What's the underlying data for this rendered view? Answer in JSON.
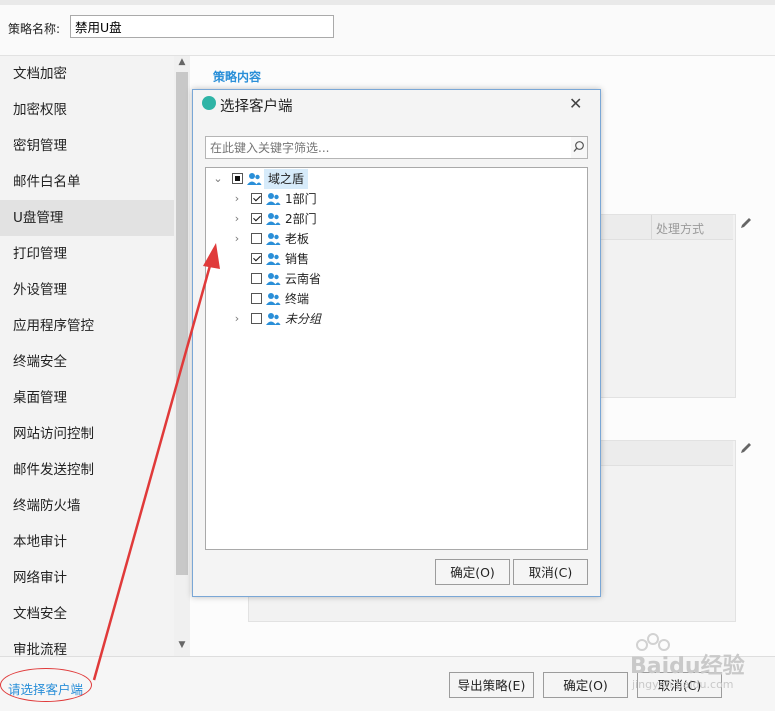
{
  "header": {
    "name_label": "策略名称:",
    "name_value": "禁用U盘"
  },
  "sidebar": {
    "items": [
      {
        "label": "文档加密"
      },
      {
        "label": "加密权限"
      },
      {
        "label": "密钥管理"
      },
      {
        "label": "邮件白名单"
      },
      {
        "label": "U盘管理",
        "active": true
      },
      {
        "label": "打印管理"
      },
      {
        "label": "外设管理"
      },
      {
        "label": "应用程序管控"
      },
      {
        "label": "终端安全"
      },
      {
        "label": "桌面管理"
      },
      {
        "label": "网站访问控制"
      },
      {
        "label": "邮件发送控制"
      },
      {
        "label": "终端防火墙"
      },
      {
        "label": "本地审计"
      },
      {
        "label": "网络审计"
      },
      {
        "label": "文档安全"
      },
      {
        "label": "审批流程"
      }
    ]
  },
  "main": {
    "section_title": "策略内容",
    "panel1_column": "处理方式"
  },
  "footer": {
    "select_client_link": "请选择客户端",
    "export_button": "导出策略(E)",
    "ok_button": "确定(O)",
    "cancel_button": "取消(C)"
  },
  "dialog": {
    "title": "选择客户端",
    "filter_placeholder": "在此键入关键字筛选...",
    "ok_button": "确定(O)",
    "cancel_button": "取消(C)",
    "tree": [
      {
        "label": "域之盾",
        "state": "partial",
        "expandable": true,
        "expanded": true,
        "level": 0
      },
      {
        "label": "1部门",
        "state": "checked",
        "expandable": true,
        "level": 1
      },
      {
        "label": "2部门",
        "state": "checked",
        "expandable": true,
        "level": 1
      },
      {
        "label": "老板",
        "state": "unchecked",
        "expandable": true,
        "level": 1
      },
      {
        "label": "销售",
        "state": "checked",
        "expandable": false,
        "level": 1
      },
      {
        "label": "云南省",
        "state": "unchecked",
        "expandable": false,
        "level": 1
      },
      {
        "label": "终端",
        "state": "unchecked",
        "expandable": false,
        "level": 1
      },
      {
        "label": "未分组",
        "state": "unchecked",
        "expandable": true,
        "level": 1,
        "italic": true
      }
    ]
  },
  "watermark": {
    "text": "Baidu经验",
    "sub": "jingyan.baidu.com"
  },
  "colors": {
    "accent": "#2a8fd8",
    "annotation": "#e03a3a",
    "user_icon": "#2a8fd8"
  }
}
